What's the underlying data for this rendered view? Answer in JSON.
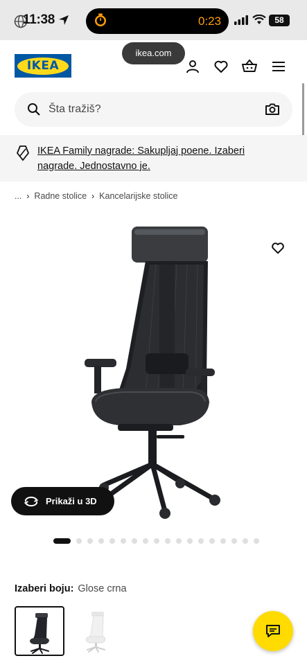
{
  "status": {
    "time": "11:38",
    "timer": "0:23",
    "battery": "58"
  },
  "browser": {
    "url": "ikea.com"
  },
  "header": {
    "logo_text": "IKEA",
    "icons": [
      "user-icon",
      "heart-icon",
      "basket-icon",
      "menu-icon"
    ]
  },
  "search": {
    "placeholder": "Šta tražiš?"
  },
  "banner": {
    "text": "IKEA Family nagrade: Sakupljaj poene. Izaberi nagrade. Jednostavno je."
  },
  "breadcrumb": {
    "ellipsis": "...",
    "items": [
      "Radne stolice",
      "Kancelarijske stolice"
    ]
  },
  "product": {
    "view3d_label": "Prikaži u 3D",
    "image_count": 18,
    "active_image": 1
  },
  "color": {
    "label": "Izaberi boju:",
    "value": "Glose crna",
    "options": [
      "black",
      "white"
    ]
  },
  "colors": {
    "ikea_blue": "#0058a3",
    "ikea_yellow": "#ffda1a",
    "timer_orange": "#ff9f0a",
    "chat_yellow": "#ffdb00"
  }
}
